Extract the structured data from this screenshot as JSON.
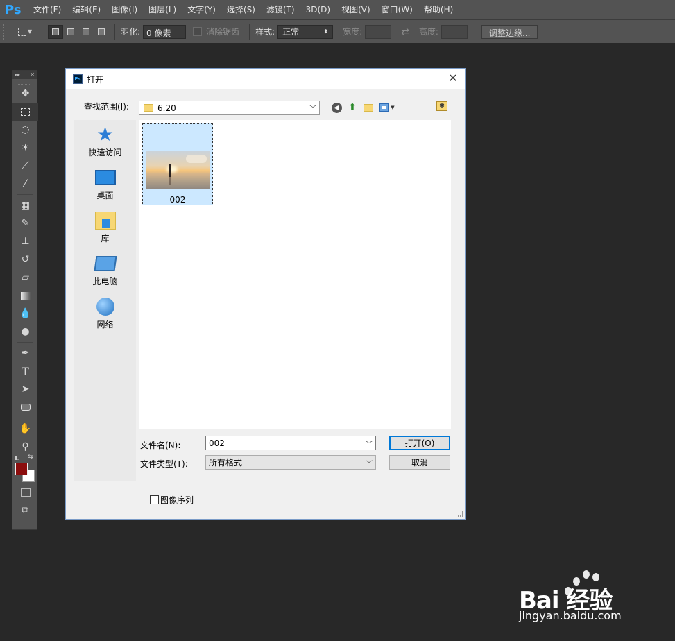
{
  "app": {
    "logo": "Ps"
  },
  "menu": [
    "文件(F)",
    "编辑(E)",
    "图像(I)",
    "图层(L)",
    "文字(Y)",
    "选择(S)",
    "滤镜(T)",
    "3D(D)",
    "视图(V)",
    "窗口(W)",
    "帮助(H)"
  ],
  "options": {
    "feather_label": "羽化:",
    "feather_value": "0 像素",
    "antialias_label": "消除锯齿",
    "style_label": "样式:",
    "style_value": "正常",
    "width_label": "宽度:",
    "height_label": "高度:",
    "refine_edge": "调整边缘..."
  },
  "toolbox": {
    "tools": [
      "move-tool",
      "marquee-tool",
      "lasso-tool",
      "magic-wand-tool",
      "crop-tool",
      "eyedropper-tool",
      "healing-brush-tool",
      "brush-tool",
      "clone-stamp-tool",
      "history-brush-tool",
      "eraser-tool",
      "gradient-tool",
      "blur-tool",
      "dodge-tool",
      "pen-tool",
      "type-tool",
      "path-selection-tool",
      "shape-tool",
      "hand-tool",
      "zoom-tool"
    ],
    "type_tool_glyph": "T",
    "foreground_color": "#8b0d0d",
    "background_color": "#ffffff"
  },
  "dialog": {
    "title": "打开",
    "look_in_label": "查找范围(I):",
    "look_in_value": "6.20",
    "places": [
      {
        "label": "快速访问",
        "icon": "star-icon"
      },
      {
        "label": "桌面",
        "icon": "desktop-icon"
      },
      {
        "label": "库",
        "icon": "library-icon"
      },
      {
        "label": "此电脑",
        "icon": "computer-icon"
      },
      {
        "label": "网络",
        "icon": "network-icon"
      }
    ],
    "files": [
      {
        "name": "002"
      }
    ],
    "filename_label": "文件名(N):",
    "filename_value": "002",
    "filetype_label": "文件类型(T):",
    "filetype_value": "所有格式",
    "open_button": "打开(O)",
    "cancel_button": "取消",
    "image_sequence_label": "图像序列"
  },
  "watermark": {
    "brand": "Bai  经验",
    "url": "jingyan.baidu.com"
  }
}
